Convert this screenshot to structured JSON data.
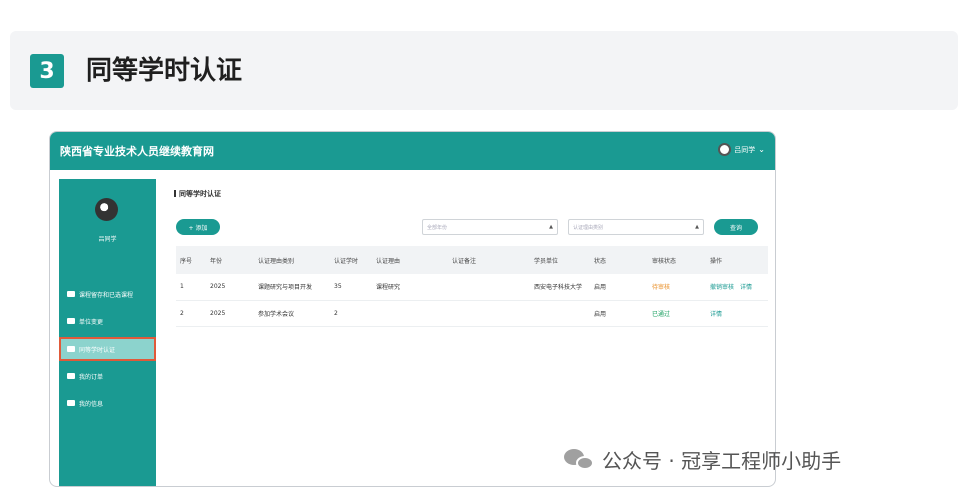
{
  "section": {
    "number": "3",
    "title": "同等学时认证"
  },
  "app": {
    "site_title": "陕西省专业技术人员继续教育网",
    "user_short": "吕同学",
    "sidebar": {
      "user_name": "吕同学",
      "items": [
        {
          "label": "课程留存和已选课程"
        },
        {
          "label": "单位变更"
        },
        {
          "label": "同等学时认证",
          "active": true
        },
        {
          "label": "我的订单"
        },
        {
          "label": "我的信息"
        }
      ]
    },
    "page_title": "同等学时认证",
    "add_label": "+ 添加",
    "filter_year_placeholder": "全部年份",
    "filter_type_placeholder": "认证理由类别",
    "query_label": "查询",
    "table": {
      "columns": [
        "序号",
        "年份",
        "认证理由类别",
        "认证学时",
        "认证理由",
        "认证备注",
        "学员单位",
        "状态",
        "审核状态",
        "操作"
      ],
      "rows": [
        {
          "no": "1",
          "year": "2025",
          "category": "课题研究与项目开发",
          "hours": "35",
          "reason": "课程研究",
          "note": "",
          "unit": "西安电子科技大学",
          "status": "启用",
          "audit": "待审核",
          "ops": "撤销审核　详情"
        },
        {
          "no": "2",
          "year": "2025",
          "category": "参加学术会议",
          "hours": "2",
          "reason": "",
          "note": "",
          "unit": "",
          "status": "启用",
          "audit": "已通过",
          "ops": "详情"
        }
      ]
    }
  },
  "watermark": {
    "text": "公众号 · 冠享工程师小助手"
  },
  "colors": {
    "accent": "#1a9a92",
    "pending": "#e9902a",
    "pass": "#1aa060"
  }
}
